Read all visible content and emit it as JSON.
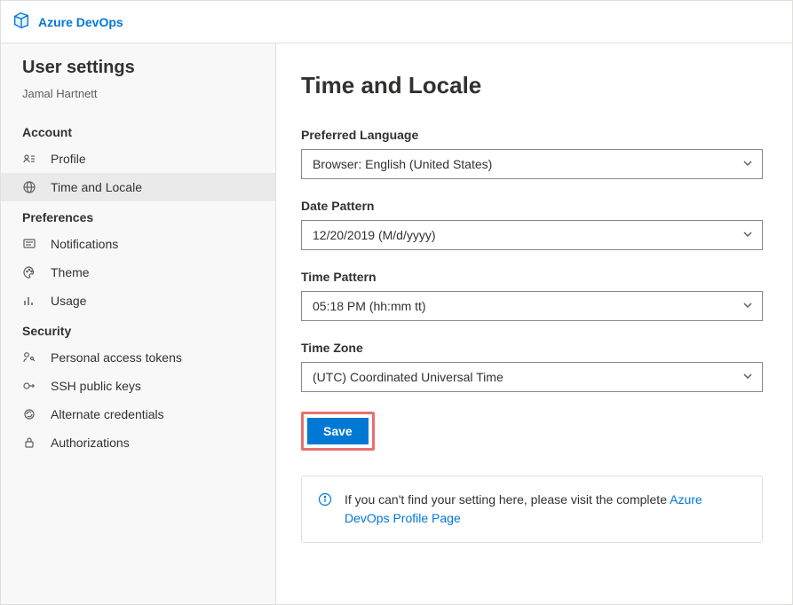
{
  "brand": {
    "product": "Azure DevOps"
  },
  "sidebar": {
    "title": "User settings",
    "subtitle": "Jamal Hartnett",
    "sections": [
      {
        "label": "Account",
        "items": [
          {
            "id": "profile",
            "label": "Profile",
            "active": false
          },
          {
            "id": "time-locale",
            "label": "Time and Locale",
            "active": true
          }
        ]
      },
      {
        "label": "Preferences",
        "items": [
          {
            "id": "notifications",
            "label": "Notifications",
            "active": false
          },
          {
            "id": "theme",
            "label": "Theme",
            "active": false
          },
          {
            "id": "usage",
            "label": "Usage",
            "active": false
          }
        ]
      },
      {
        "label": "Security",
        "items": [
          {
            "id": "pat",
            "label": "Personal access tokens",
            "active": false
          },
          {
            "id": "ssh",
            "label": "SSH public keys",
            "active": false
          },
          {
            "id": "altcreds",
            "label": "Alternate credentials",
            "active": false
          },
          {
            "id": "authz",
            "label": "Authorizations",
            "active": false
          }
        ]
      }
    ]
  },
  "main": {
    "title": "Time and Locale",
    "fields": {
      "language": {
        "label": "Preferred Language",
        "value": "Browser: English (United States)"
      },
      "date": {
        "label": "Date Pattern",
        "value": "12/20/2019 (M/d/yyyy)"
      },
      "time": {
        "label": "Time Pattern",
        "value": "05:18 PM (hh:mm tt)"
      },
      "tz": {
        "label": "Time Zone",
        "value": "(UTC) Coordinated Universal Time"
      }
    },
    "save_label": "Save",
    "info": {
      "pre": "If you can't find your setting here, please visit the complete ",
      "link": "Azure DevOps Profile Page"
    }
  }
}
